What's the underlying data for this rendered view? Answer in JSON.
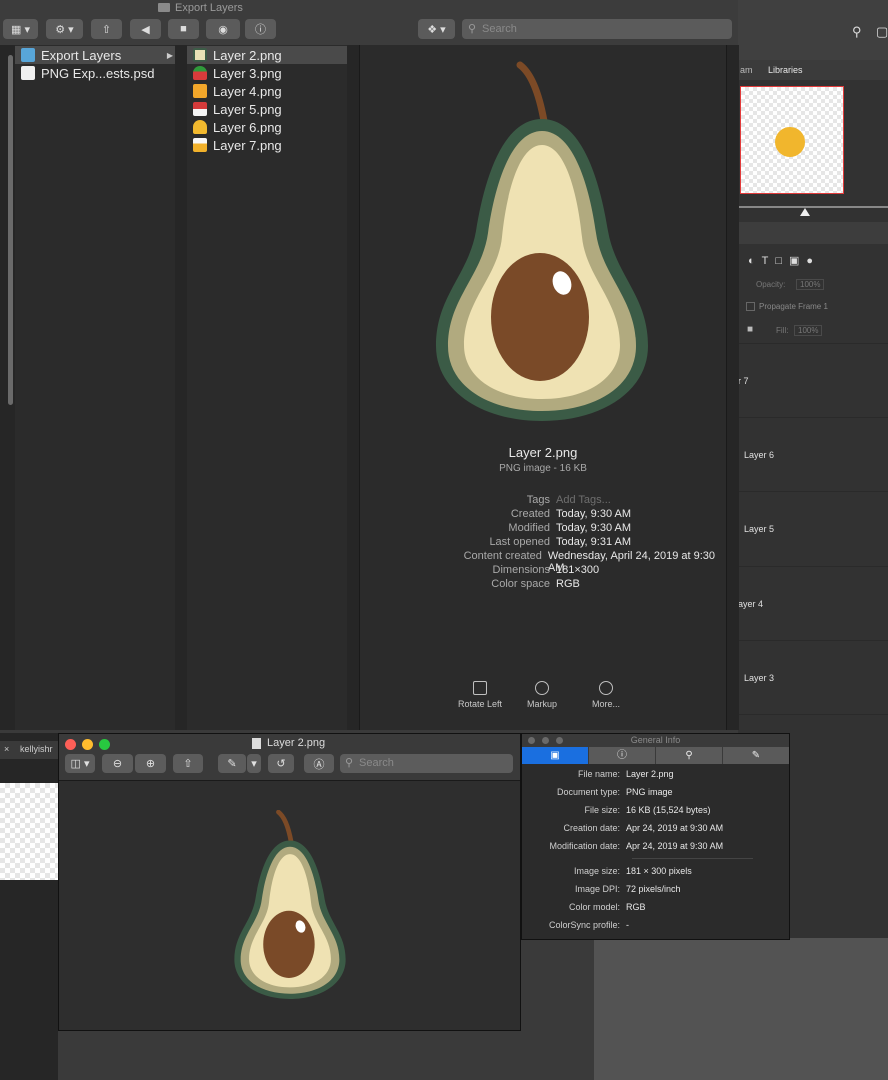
{
  "finder": {
    "title": "Export Layers",
    "search_placeholder": "Search",
    "col1": [
      {
        "label": "Export Layers",
        "selected": true
      },
      {
        "label": "PNG Exp...ests.psd",
        "selected": false
      }
    ],
    "col2": [
      {
        "label": "Layer 2.png",
        "selected": true
      },
      {
        "label": "Layer 3.png",
        "selected": false
      },
      {
        "label": "Layer 4.png",
        "selected": false
      },
      {
        "label": "Layer 5.png",
        "selected": false
      },
      {
        "label": "Layer 6.png",
        "selected": false
      },
      {
        "label": "Layer 7.png",
        "selected": false
      }
    ],
    "preview": {
      "filename": "Layer 2.png",
      "kind": "PNG image - 16 KB",
      "meta": [
        {
          "k": "Tags",
          "v": "Add Tags..."
        },
        {
          "k": "Created",
          "v": "Today, 9:30 AM"
        },
        {
          "k": "Modified",
          "v": "Today, 9:30 AM"
        },
        {
          "k": "Last opened",
          "v": "Today, 9:31 AM"
        },
        {
          "k": "Content created",
          "v": "Wednesday, April 24, 2019 at 9:30 AM"
        },
        {
          "k": "Dimensions",
          "v": "181×300"
        },
        {
          "k": "Color space",
          "v": "RGB"
        }
      ],
      "actions": [
        "Rotate Left",
        "Markup",
        "More..."
      ]
    }
  },
  "preview_window": {
    "title": "Layer 2.png",
    "search_placeholder": "Search",
    "behind_tab": "kellyishr"
  },
  "general_info": {
    "title": "General Info",
    "rows": [
      {
        "k": "File name:",
        "v": "Layer 2.png"
      },
      {
        "k": "Document type:",
        "v": "PNG image"
      },
      {
        "k": "File size:",
        "v": "16 KB (15,524 bytes)"
      },
      {
        "k": "Creation date:",
        "v": "Apr 24, 2019 at 9:30 AM"
      },
      {
        "k": "Modification date:",
        "v": "Apr 24, 2019 at 9:30 AM"
      },
      {
        "k": "Image size:",
        "v": "181 × 300 pixels"
      },
      {
        "k": "Image DPI:",
        "v": "72 pixels/inch"
      },
      {
        "k": "Color model:",
        "v": "RGB"
      },
      {
        "k": "ColorSync profile:",
        "v": "-"
      }
    ]
  },
  "photoshop": {
    "tab_left": "am",
    "tab_libraries": "Libraries",
    "opacity_label": "Opacity:",
    "opacity_value": "100%",
    "propagate": "Propagate Frame 1",
    "fill_label": "Fill:",
    "fill_value": "100%",
    "layers": [
      "r 7",
      "Layer 6",
      "Layer 5",
      "ayer 4",
      "Layer 3"
    ]
  },
  "colors": {
    "selection": "#1a6fe0",
    "avocado_skin": "#3a5a45",
    "avocado_flesh": "#efe2b3",
    "pit": "#7a4a28"
  }
}
